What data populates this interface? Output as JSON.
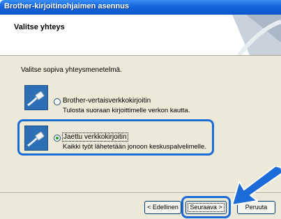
{
  "window": {
    "title": "Brother-kirjoitinohjaimen asennus"
  },
  "header": {
    "title": "Valitse yhteys"
  },
  "instruction": "Valitse sopiva yhteysmenetelmä.",
  "options": [
    {
      "label": "Brother-vertaisverkkokirjoitin",
      "description": "Tulosta suoraan kirjoittimelle verkon kautta.",
      "selected": false
    },
    {
      "label": "Jaettu verkkokirjoitin",
      "description": "Kaikki työt lähetetään jonoon keskuspalvelimelle.",
      "selected": true
    }
  ],
  "buttons": {
    "back": "< Edellinen",
    "next": "Seuraava >",
    "cancel": "Peruuta"
  },
  "colors": {
    "titlebar": "#0b55cc",
    "highlight": "#1b6bd8",
    "dialog_bg": "#ece9d8"
  }
}
